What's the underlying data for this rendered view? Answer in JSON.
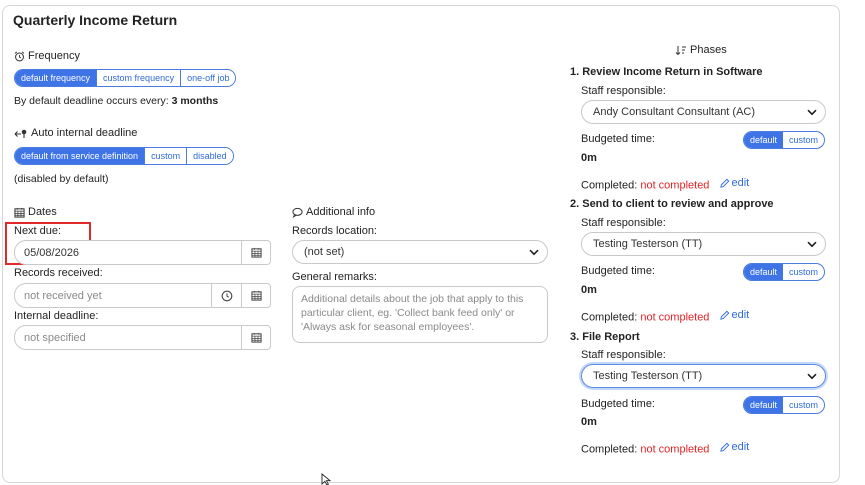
{
  "title": "Quarterly Income Return",
  "frequency": {
    "label": "Frequency",
    "options": [
      "default frequency",
      "custom frequency",
      "one-off job"
    ],
    "note_prefix": "By default deadline occurs every:",
    "note_value": "3 months"
  },
  "auto_deadline": {
    "label": "Auto internal deadline",
    "options": [
      "default from service definition",
      "custom",
      "disabled"
    ],
    "note": "(disabled by default)"
  },
  "dates": {
    "label": "Dates",
    "next_due_label": "Next due:",
    "next_due_value": "05/08/2026",
    "records_received_label": "Records received:",
    "records_received_placeholder": "not received yet",
    "internal_deadline_label": "Internal deadline:",
    "internal_deadline_placeholder": "not specified"
  },
  "additional": {
    "label": "Additional info",
    "records_location_label": "Records location:",
    "records_location_value": "(not set)",
    "remarks_label": "General remarks:",
    "remarks_placeholder": "Additional details about the job that apply to this particular client, eg. 'Collect bank feed only' or 'Always ask for seasonal employees'."
  },
  "phases": {
    "label": "Phases",
    "staff_label": "Staff responsible:",
    "budget_label": "Budgeted time:",
    "completed_label": "Completed:",
    "default_label": "default",
    "custom_label": "custom",
    "edit_label": "edit",
    "items": [
      {
        "title": "1. Review Income Return in Software",
        "staff": "Andy Consultant Consultant (AC)",
        "budget": "0m",
        "status": "not completed"
      },
      {
        "title": "2. Send to client to review and approve",
        "staff": "Testing Testerson (TT)",
        "budget": "0m",
        "status": "not completed"
      },
      {
        "title": "3. File Report",
        "staff": "Testing Testerson (TT)",
        "budget": "0m",
        "status": "not completed"
      }
    ]
  },
  "colors": {
    "accent": "#3e74e6",
    "status_red": "#e0242b",
    "highlight": "#e02a2a"
  }
}
